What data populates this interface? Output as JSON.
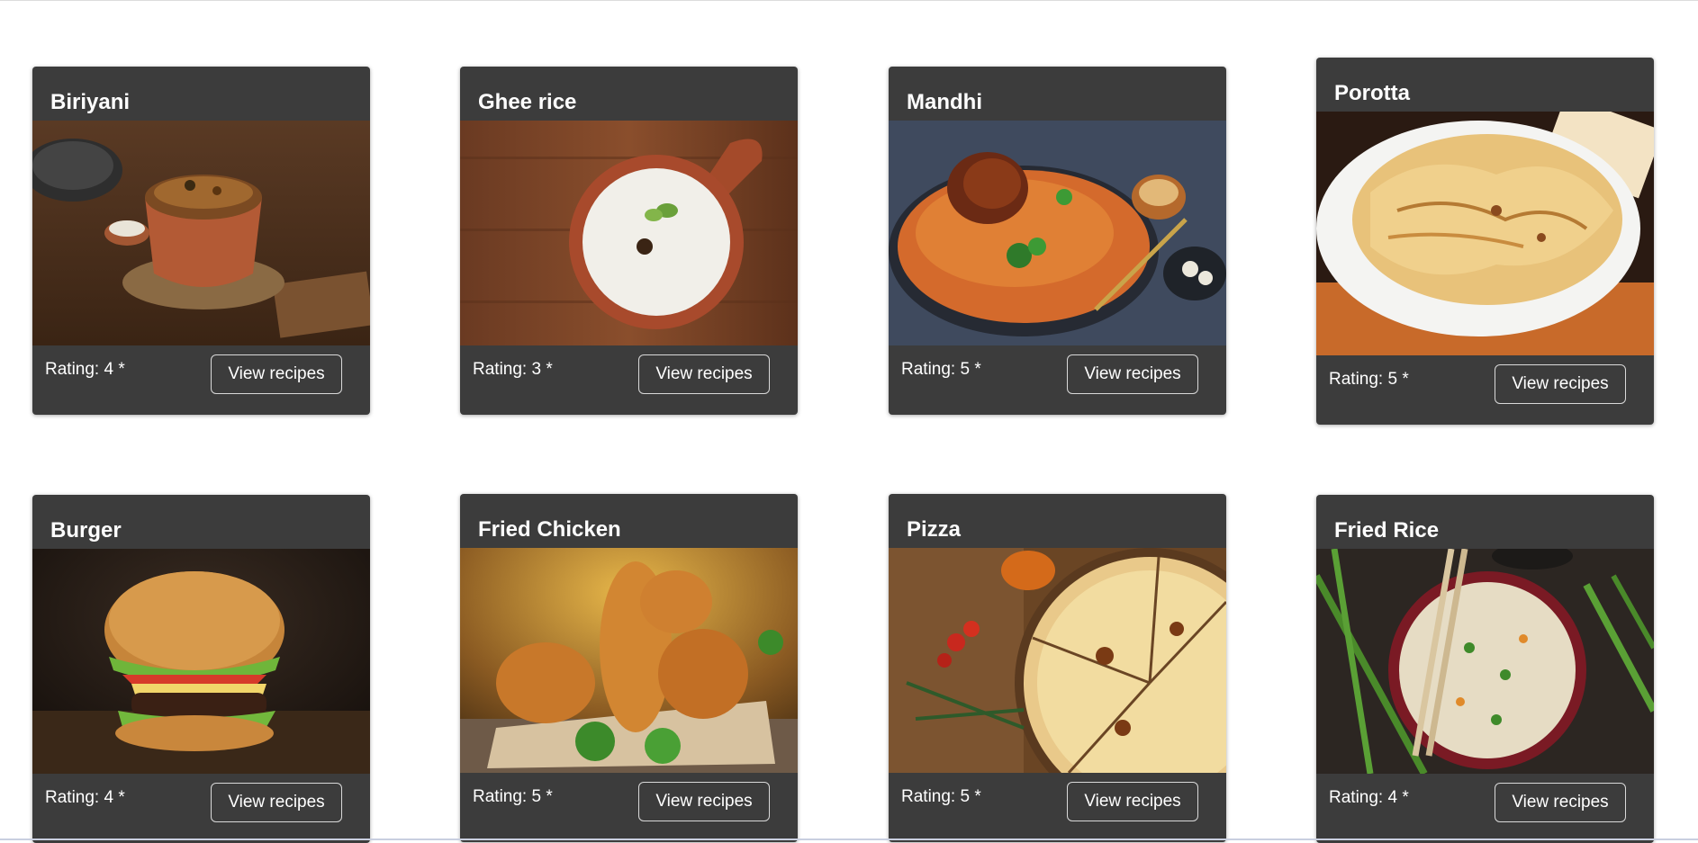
{
  "recipes": [
    {
      "name": "Biriyani",
      "rating": "Rating: 4 *",
      "button": "View recipes",
      "image": "biriyani-photo"
    },
    {
      "name": "Ghee rice",
      "rating": "Rating: 3 *",
      "button": "View recipes",
      "image": "ghee-rice-photo"
    },
    {
      "name": "Mandhi",
      "rating": "Rating: 5 *",
      "button": "View recipes",
      "image": "mandhi-photo"
    },
    {
      "name": "Porotta",
      "rating": "Rating: 5 *",
      "button": "View recipes",
      "image": "porotta-photo"
    },
    {
      "name": "Burger",
      "rating": "Rating: 4 *",
      "button": "View recipes",
      "image": "burger-photo"
    },
    {
      "name": "Fried Chicken",
      "rating": "Rating: 5 *",
      "button": "View recipes",
      "image": "fried-chicken-photo"
    },
    {
      "name": "Pizza",
      "rating": "Rating: 5 *",
      "button": "View recipes",
      "image": "pizza-photo"
    },
    {
      "name": "Fried Rice",
      "rating": "Rating: 4 *",
      "button": "View recipes",
      "image": "fried-rice-photo"
    }
  ],
  "colors": {
    "card_background": "#3c3c3c",
    "text": "#ffffff",
    "button_border": "#d9d9d9",
    "page_background": "#ffffff"
  }
}
